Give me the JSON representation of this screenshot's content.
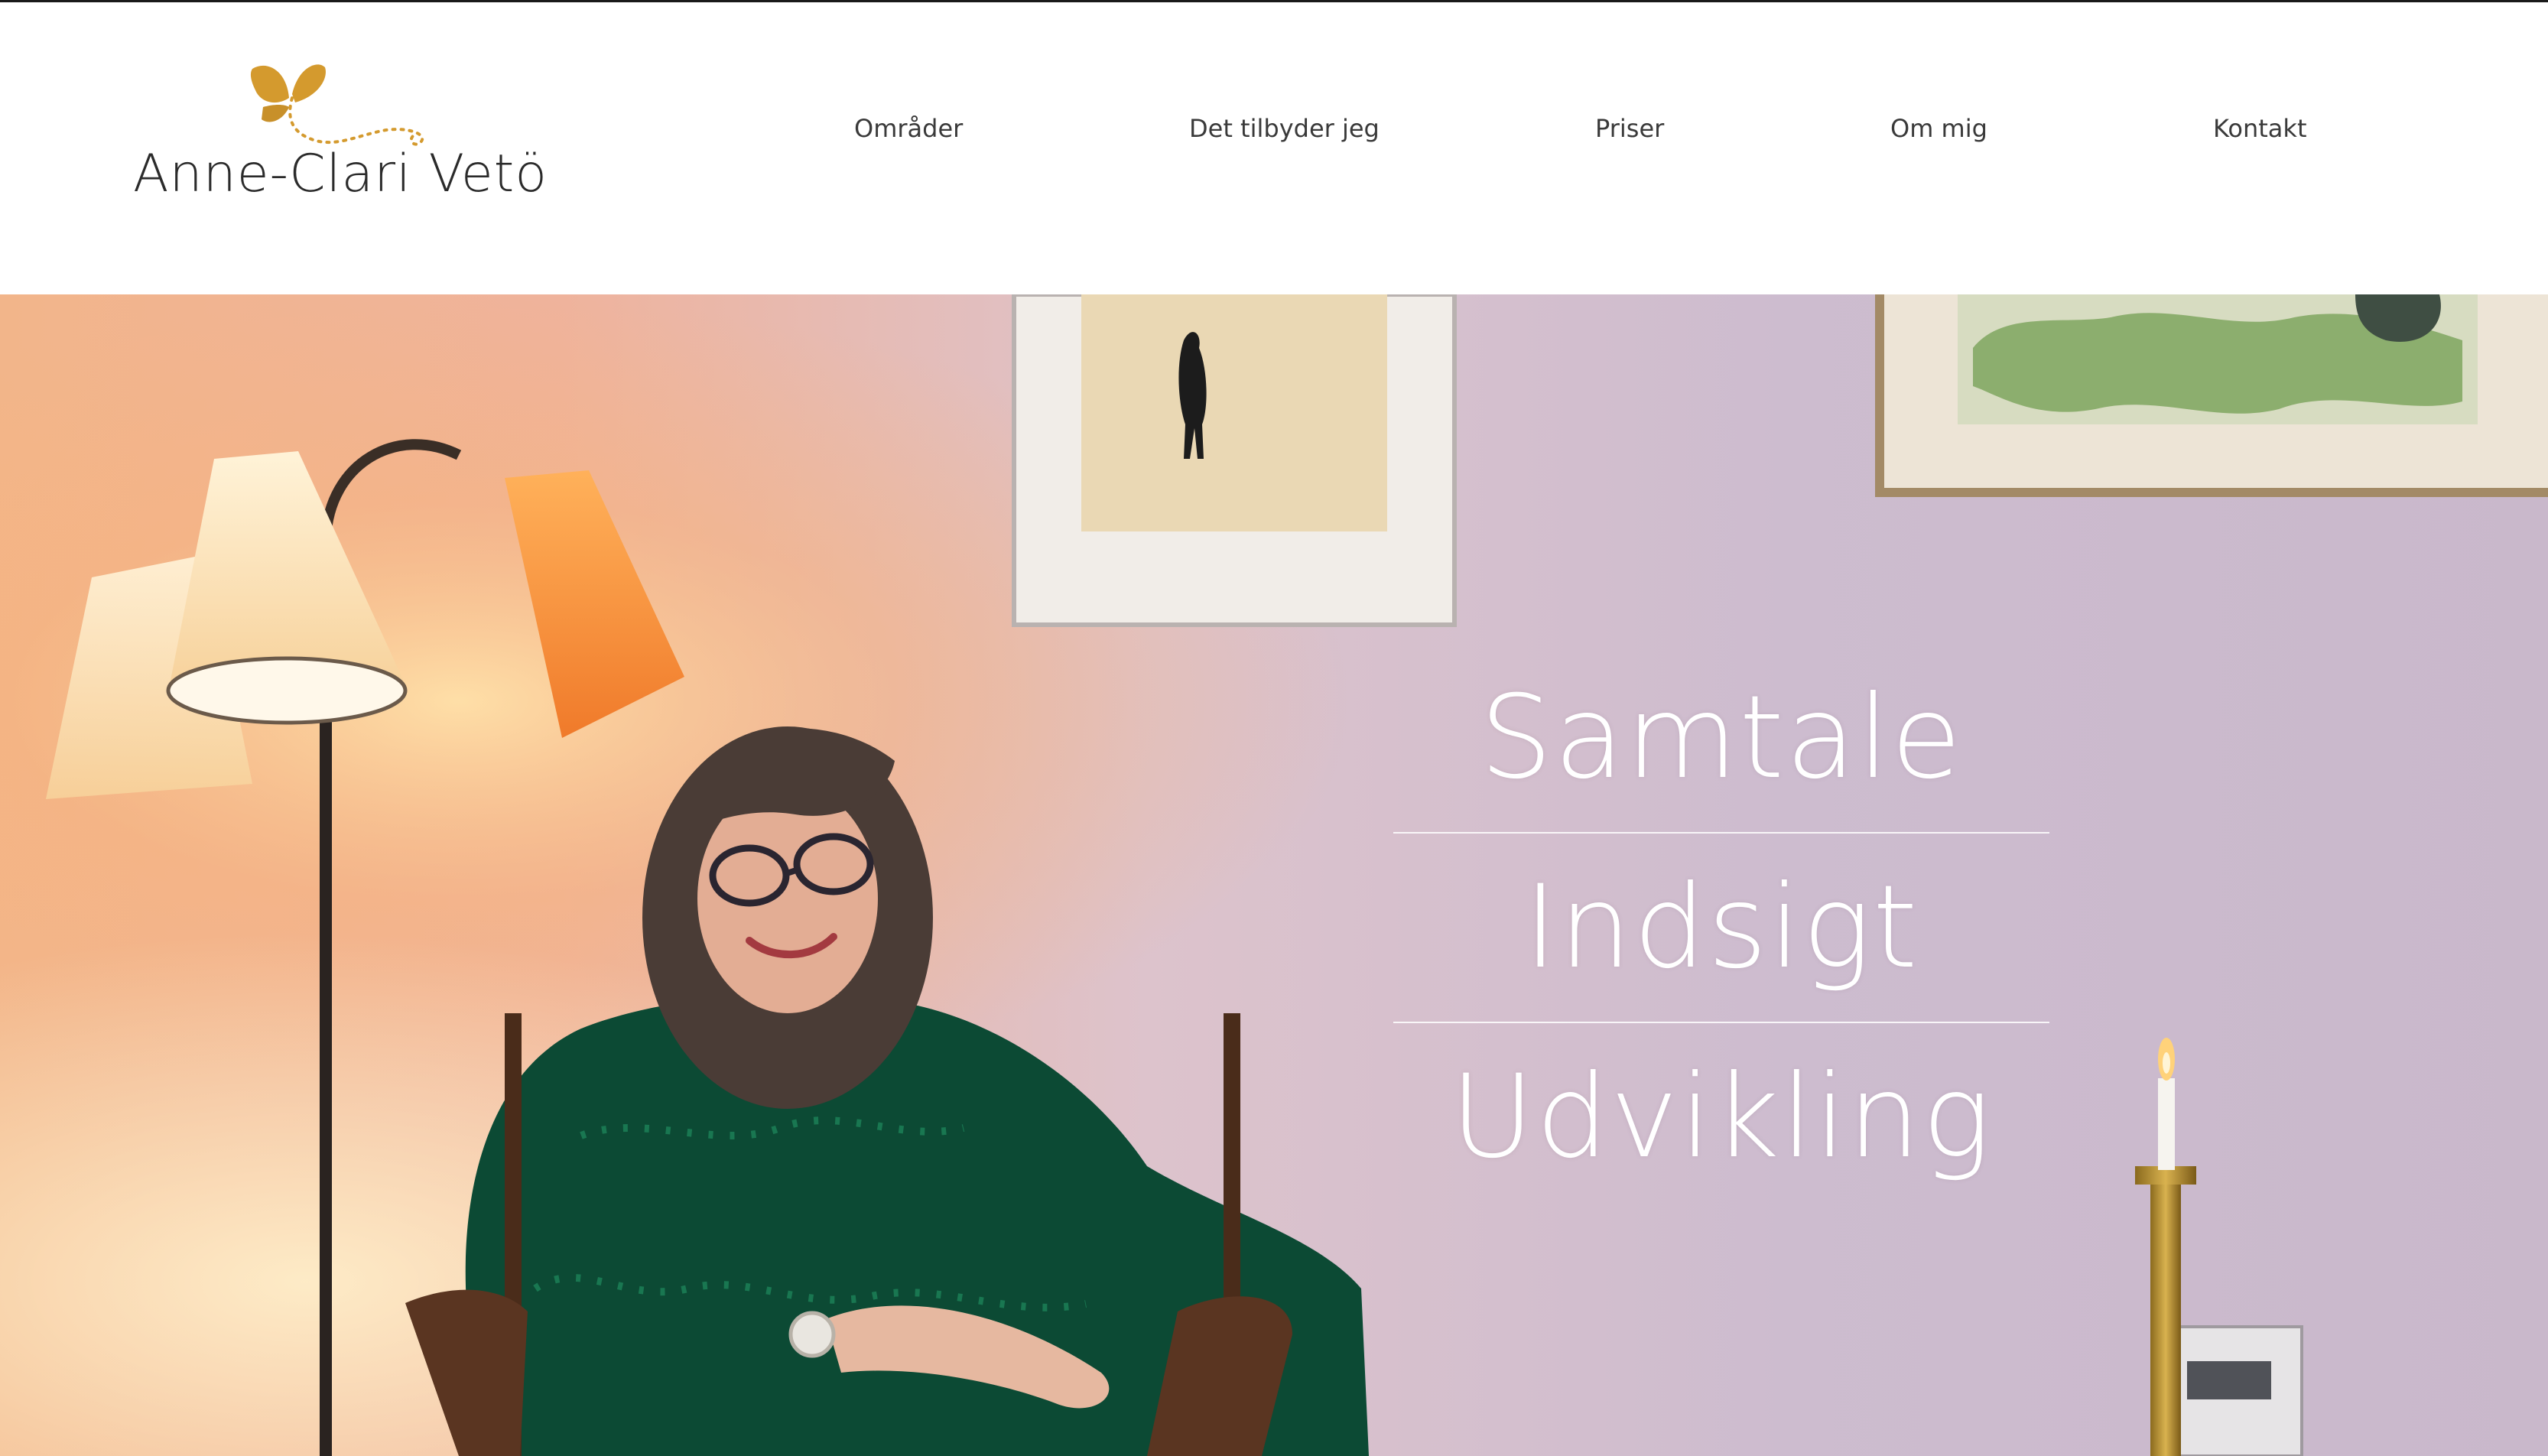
{
  "brand": {
    "name": "Anne-Clari Vetö",
    "logo_icon": "butterfly-icon",
    "accent_color": "#d49a2e"
  },
  "nav": {
    "items": [
      {
        "label": "Områder"
      },
      {
        "label": "Det tilbyder jeg"
      },
      {
        "label": "Priser"
      },
      {
        "label": "Om mig"
      },
      {
        "label": "Kontakt"
      }
    ]
  },
  "hero": {
    "words": [
      "Samtale",
      "Indsigt",
      "Udvikling"
    ],
    "text_color": "#ffffff"
  }
}
